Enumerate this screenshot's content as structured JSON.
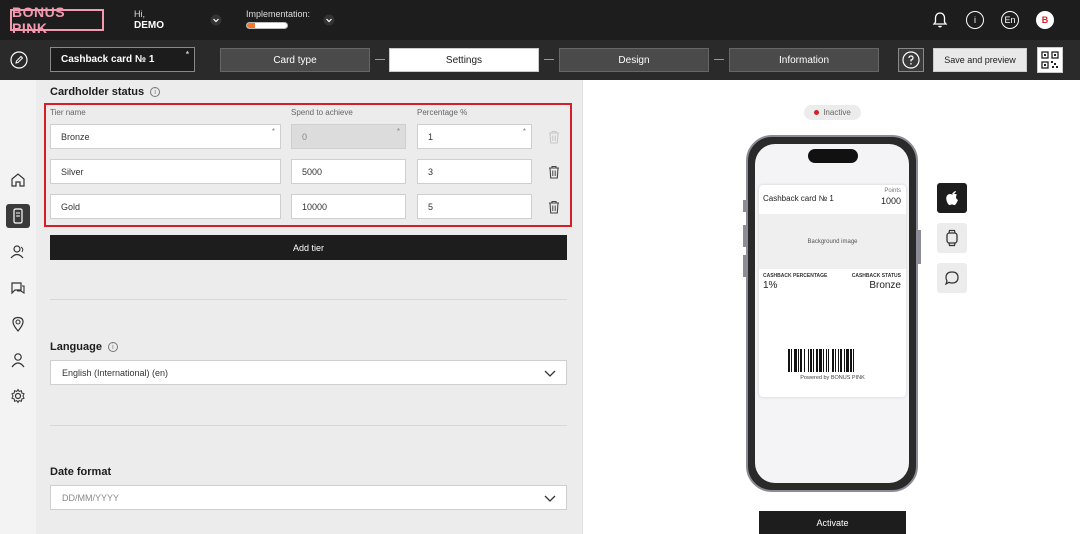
{
  "brand": {
    "logo_text": "BONUS PINK",
    "accent": "#f29ab0"
  },
  "header": {
    "greeting": "Hi,",
    "user": "DEMO",
    "implementation_label": "Implementation:",
    "implementation_progress": 0.2,
    "language_badge": "En",
    "avatar_letter": "B",
    "icons": [
      "bell-icon",
      "info-icon",
      "language-icon",
      "avatar"
    ]
  },
  "steps": {
    "card_name": "Cashback card № 1",
    "card_name_required": "*",
    "items": [
      {
        "label": "Card type",
        "active": false
      },
      {
        "label": "Settings",
        "active": true
      },
      {
        "label": "Design",
        "active": false
      },
      {
        "label": "Information",
        "active": false
      }
    ],
    "save_label": "Save and preview"
  },
  "sidebar": {
    "items": [
      "home-icon",
      "card-icon",
      "customers-icon",
      "messages-icon",
      "location-icon",
      "user-icon",
      "settings-icon"
    ]
  },
  "cardholder_status": {
    "title": "Cardholder status",
    "columns": [
      "Tier name",
      "Spend to achieve",
      "Percentage %"
    ],
    "required_mark": "*",
    "tiers": [
      {
        "name": "Bronze",
        "spend": "0",
        "percentage": "1"
      },
      {
        "name": "Silver",
        "spend": "5000",
        "percentage": "3"
      },
      {
        "name": "Gold",
        "spend": "10000",
        "percentage": "5"
      }
    ],
    "add_tier_label": "Add tier",
    "highlight_color": "#d32027"
  },
  "language": {
    "title": "Language",
    "value": "English (International) (en)"
  },
  "date_format": {
    "title": "Date format",
    "placeholder": "DD/MM/YYYY"
  },
  "preview": {
    "status_label": "Inactive",
    "status_color": "#d32027",
    "pass": {
      "title": "Cashback card № 1",
      "points_label": "Points",
      "points_value": "1000",
      "image_label": "Background image",
      "left_field_label": "CASHBACK PERCENTAGE",
      "left_field_value": "1%",
      "right_field_label": "CASHBACK STATUS",
      "right_field_value": "Bronze",
      "powered_by": "Powered by BONUS PINK"
    },
    "platforms": [
      "apple-icon",
      "watch-icon",
      "chat-icon"
    ],
    "activate_label": "Activate"
  }
}
